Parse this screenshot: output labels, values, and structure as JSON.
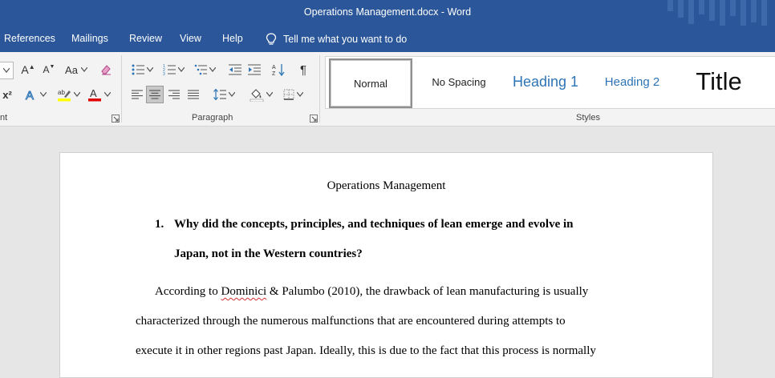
{
  "window": {
    "title": "Operations Management.docx  -  Word"
  },
  "menu": {
    "items": [
      "References",
      "Mailings",
      "Review",
      "View",
      "Help"
    ],
    "tell_me": "Tell me what you want to do"
  },
  "ribbon": {
    "font_group_label": "nt",
    "paragraph_group_label": "Paragraph",
    "styles_group_label": "Styles",
    "font_buttons": {
      "grow": "A",
      "shrink": "A",
      "case": "Aa",
      "superscript": "x²"
    },
    "styles": [
      "Normal",
      "No Spacing",
      "Heading 1",
      "Heading 2",
      "Title"
    ],
    "colors": {
      "accent": "#2b579a",
      "highlight": "#ffff00",
      "font_color": "#e00000"
    }
  },
  "document": {
    "title": "Operations Management",
    "question_number": "1.",
    "question_lines": [
      "Why did the concepts, principles, and techniques of lean emerge and evolve in",
      "Japan, not in the Western countries?"
    ],
    "para_line1_start": "According to ",
    "para_line1_misspelled": "Dominici",
    "para_line1_end": " & Palumbo (2010), the drawback of lean manufacturing is usually",
    "para_line2": "characterized through the numerous malfunctions that are encountered during attempts to",
    "para_line3": "execute it in other regions past Japan. Ideally, this is due to the fact that this process is normally"
  }
}
